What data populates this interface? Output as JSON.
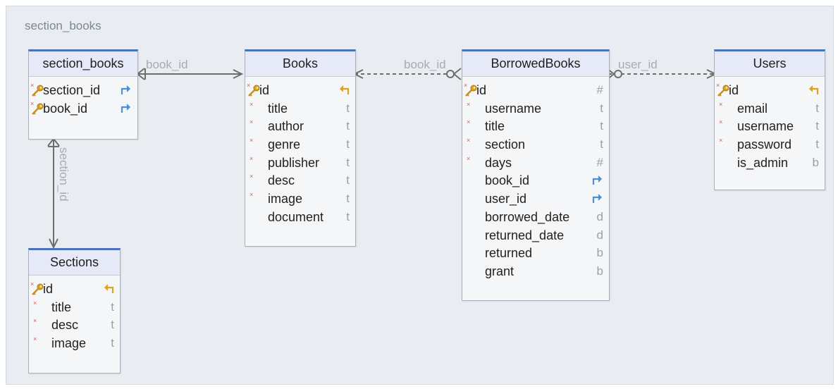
{
  "diagram": {
    "title": "section_books"
  },
  "tables": [
    {
      "id": "section_books",
      "name": "section_books",
      "columns": [
        {
          "name": "section_id",
          "type": "",
          "key": true,
          "required": true,
          "ref": "fk"
        },
        {
          "name": "book_id",
          "type": "",
          "key": true,
          "required": true,
          "ref": "fk"
        }
      ]
    },
    {
      "id": "books",
      "name": "Books",
      "columns": [
        {
          "name": "id",
          "type": "",
          "key": true,
          "required": true,
          "ref": "pk"
        },
        {
          "name": "title",
          "type": "t",
          "required": true
        },
        {
          "name": "author",
          "type": "t",
          "required": true
        },
        {
          "name": "genre",
          "type": "t",
          "required": true
        },
        {
          "name": "publisher",
          "type": "t",
          "required": true
        },
        {
          "name": "desc",
          "type": "t",
          "required": true
        },
        {
          "name": "image",
          "type": "t",
          "required": true
        },
        {
          "name": "document",
          "type": "t",
          "required": false
        }
      ]
    },
    {
      "id": "borrowedbooks",
      "name": "BorrowedBooks",
      "columns": [
        {
          "name": "id",
          "type": "#",
          "key": true,
          "required": true
        },
        {
          "name": "username",
          "type": "t",
          "required": true
        },
        {
          "name": "title",
          "type": "t",
          "required": true
        },
        {
          "name": "section",
          "type": "t",
          "required": true
        },
        {
          "name": "days",
          "type": "#",
          "required": true
        },
        {
          "name": "book_id",
          "type": "",
          "required": false,
          "ref": "fk"
        },
        {
          "name": "user_id",
          "type": "",
          "required": false,
          "ref": "fk"
        },
        {
          "name": "borrowed_date",
          "type": "d",
          "required": false
        },
        {
          "name": "returned_date",
          "type": "d",
          "required": false
        },
        {
          "name": "returned",
          "type": "b",
          "required": false
        },
        {
          "name": "grant",
          "type": "b",
          "required": false
        }
      ]
    },
    {
      "id": "users",
      "name": "Users",
      "columns": [
        {
          "name": "id",
          "type": "",
          "key": true,
          "required": true,
          "ref": "pk"
        },
        {
          "name": "email",
          "type": "t",
          "required": true
        },
        {
          "name": "username",
          "type": "t",
          "required": true
        },
        {
          "name": "password",
          "type": "t",
          "required": true
        },
        {
          "name": "is_admin",
          "type": "b",
          "required": false
        }
      ]
    },
    {
      "id": "sections",
      "name": "Sections",
      "columns": [
        {
          "name": "id",
          "type": "",
          "key": true,
          "required": true,
          "ref": "pk"
        },
        {
          "name": "title",
          "type": "t",
          "required": true
        },
        {
          "name": "desc",
          "type": "t",
          "required": true
        },
        {
          "name": "image",
          "type": "t",
          "required": true
        }
      ]
    }
  ],
  "relationships": [
    {
      "id": "rel-sb-books",
      "label": "book_id",
      "from": "section_books",
      "to": "Books",
      "style": "solid"
    },
    {
      "id": "rel-bb-books",
      "label": "book_id",
      "from": "BorrowedBooks",
      "to": "Books",
      "style": "dashed"
    },
    {
      "id": "rel-bb-users",
      "label": "user_id",
      "from": "BorrowedBooks",
      "to": "Users",
      "style": "dashed"
    },
    {
      "id": "rel-sb-sections",
      "label": "section_id",
      "from": "section_books",
      "to": "Sections",
      "style": "solid"
    }
  ],
  "colors": {
    "canvas": "#e9edf2",
    "table_header_bg": "#e6eaf8",
    "table_top_border": "#4a72b8",
    "link_line": "#6d6d6d",
    "key_icon": "#d9a520",
    "ref_icon": "#4a90d9",
    "required_mark": "#d35a5a"
  }
}
